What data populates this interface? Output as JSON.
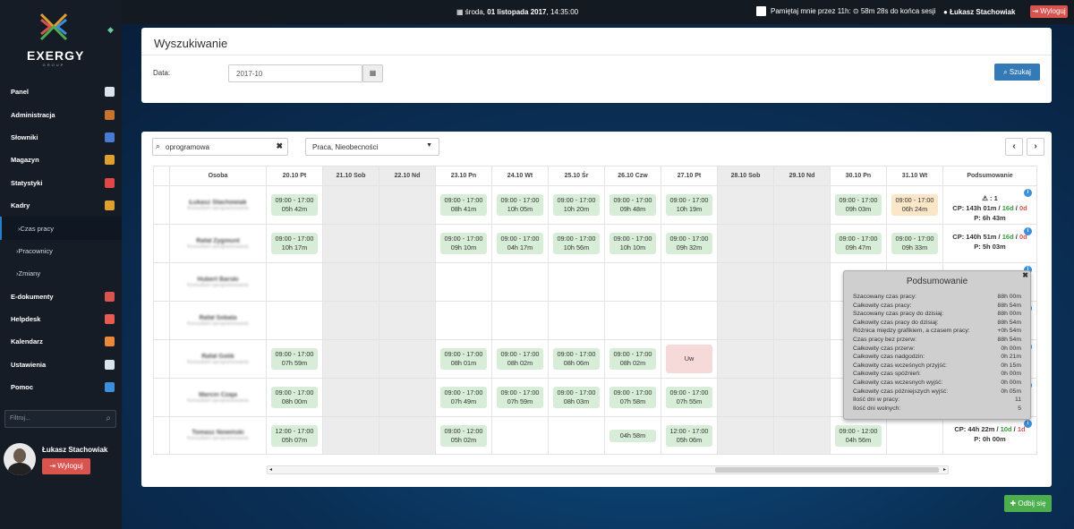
{
  "topbar": {
    "date_prefix": "środa, ",
    "date_bold": "01 listopada 2017",
    "date_time": ", 14:35:00",
    "remember_text": "Pamiętaj mnie przez 11h: ⊙ 58m 28s  do końca sesji",
    "user_name": "Łukasz Stachowiak",
    "logout_label": "Wyloguj"
  },
  "sidebar": {
    "brand": "EXERGY",
    "brand_sub": "GROUP",
    "items": [
      {
        "label": "Panel",
        "icon": "home-icon",
        "color": "#d9e4ef"
      },
      {
        "label": "Administracja",
        "icon": "books-icon",
        "color": "#c9742e"
      },
      {
        "label": "Słowniki",
        "icon": "book-icon",
        "color": "#4a7bd0"
      },
      {
        "label": "Magazyn",
        "icon": "truck-icon",
        "color": "#e0a030"
      },
      {
        "label": "Statystyki",
        "icon": "pie-chart-icon",
        "color": "#e04848"
      },
      {
        "label": "Kadry",
        "icon": "pencil-icon",
        "color": "#e0a030"
      },
      {
        "label": "Czas pracy",
        "icon": "",
        "sub": true,
        "active": true
      },
      {
        "label": "Pracownicy",
        "icon": "",
        "sub": true
      },
      {
        "label": "Zmiany",
        "icon": "",
        "sub": true
      },
      {
        "label": "E-dokumenty",
        "icon": "pdf-icon",
        "color": "#d9534f"
      },
      {
        "label": "Helpdesk",
        "icon": "lifebuoy-icon",
        "color": "#e85a4f"
      },
      {
        "label": "Kalendarz",
        "icon": "calendar-icon",
        "color": "#e88a3a"
      },
      {
        "label": "Ustawienia",
        "icon": "gear-icon",
        "color": "#d9e4ef"
      },
      {
        "label": "Pomoc",
        "icon": "help-icon",
        "color": "#3b8fdc"
      }
    ],
    "filter_placeholder": "Filtruj...",
    "user_name": "Łukasz Stachowiak",
    "logout_label": "Wyloguj"
  },
  "search": {
    "title": "Wyszukiwanie",
    "date_label": "Data:",
    "date_value": "2017-10",
    "search_button": "Szukaj"
  },
  "grid": {
    "filter_value": "oprogramowa",
    "type_select": "Praca, Nieobecności",
    "headers": [
      "Osoba",
      "20.10 Pt",
      "21.10 Sob",
      "22.10 Nd",
      "23.10 Pn",
      "24.10 Wt",
      "25.10 Śr",
      "26.10 Czw",
      "27.10 Pt",
      "28.10 Sob",
      "29.10 Nd",
      "30.10 Pn",
      "31.10 Wt",
      "Podsumowanie"
    ],
    "weekend_cols": [
      2,
      3,
      9,
      10
    ],
    "rows": [
      {
        "name": "Łukasz Stachowiak",
        "role": "Konsultant oprogramowania",
        "cells": [
          [
            "09:00 - 17:00",
            "05h 42m"
          ],
          null,
          null,
          [
            "09:00 - 17:00",
            "08h 41m"
          ],
          [
            "09:00 - 17:00",
            "10h 05m"
          ],
          [
            "09:00 - 17:00",
            "10h 20m"
          ],
          [
            "09:00 - 17:00",
            "09h 48m"
          ],
          [
            "09:00 - 17:00",
            "10h 19m"
          ],
          null,
          null,
          [
            "09:00 - 17:00",
            "09h 03m"
          ],
          [
            "09:00 - 17:00",
            "06h 24m",
            "warn"
          ]
        ],
        "summary": {
          "warn": "⚠ : 1",
          "cp": "CP: 143h 01m / ",
          "g": "16d",
          "r": "0d",
          "p": "P: 6h 43m"
        }
      },
      {
        "name": "Rafał Zygmunt",
        "role": "Konsultant oprogramowania",
        "cells": [
          [
            "09:00 - 17:00",
            "10h 17m"
          ],
          null,
          null,
          [
            "09:00 - 17:00",
            "09h 10m"
          ],
          [
            "09:00 - 17:00",
            "04h 17m"
          ],
          [
            "09:00 - 17:00",
            "10h 56m"
          ],
          [
            "09:00 - 17:00",
            "10h 10m"
          ],
          [
            "09:00 - 17:00",
            "09h 32m"
          ],
          null,
          null,
          [
            "09:00 - 17:00",
            "09h 47m"
          ],
          [
            "09:00 - 17:00",
            "09h 33m"
          ]
        ],
        "summary": {
          "warn": "",
          "cp": "CP: 140h 51m / ",
          "g": "16d",
          "r": "0d",
          "p": "P: 5h 03m"
        }
      },
      {
        "name": "Hubert Barski",
        "role": "Konsultant oprogramowania",
        "cells": [
          null,
          null,
          null,
          null,
          null,
          null,
          null,
          null,
          null,
          null,
          null,
          null
        ],
        "summary": null
      },
      {
        "name": "Rafał Sobala",
        "role": "Konsultant oprogramowania",
        "cells": [
          null,
          null,
          null,
          null,
          null,
          null,
          null,
          null,
          null,
          null,
          null,
          null
        ],
        "summary": null
      },
      {
        "name": "Rafał Golik",
        "role": "Konsultant oprogramowania",
        "cells": [
          [
            "09:00 - 17:00",
            "07h 59m"
          ],
          null,
          null,
          [
            "09:00 - 17:00",
            "08h 01m"
          ],
          [
            "09:00 - 17:00",
            "08h 02m"
          ],
          [
            "09:00 - 17:00",
            "08h 06m"
          ],
          [
            "09:00 - 17:00",
            "08h 02m"
          ],
          [
            "Uw",
            "",
            "uw"
          ],
          null,
          null,
          null,
          null
        ],
        "summary": null
      },
      {
        "name": "Marcin Czaja",
        "role": "Konsultant oprogramowania",
        "cells": [
          [
            "09:00 - 17:00",
            "08h 00m"
          ],
          null,
          null,
          [
            "09:00 - 17:00",
            "07h 49m"
          ],
          [
            "09:00 - 17:00",
            "07h 59m"
          ],
          [
            "09:00 - 17:00",
            "08h 03m"
          ],
          [
            "09:00 - 17:00",
            "07h 58m"
          ],
          [
            "09:00 - 17:00",
            "07h 55m"
          ],
          null,
          null,
          null,
          null
        ],
        "summary": null
      },
      {
        "name": "Tomasz Nowiński",
        "role": "Konsultant oprogramowania",
        "cells": [
          [
            "12:00 - 17:00",
            "05h 07m"
          ],
          null,
          null,
          [
            "09:00 - 12:00",
            "05h 02m"
          ],
          null,
          null,
          [
            "",
            "04h 58m"
          ],
          [
            "12:00 - 17:00",
            "05h 06m"
          ],
          null,
          null,
          [
            "09:00 - 12:00",
            "04h 56m"
          ],
          null
        ],
        "summary": {
          "warn": "",
          "cp": "CP: 44h 22m / ",
          "g": "10d",
          "r": "1d",
          "p": "P: 0h 00m"
        }
      }
    ]
  },
  "popover": {
    "title": "Podsumowanie",
    "rows": [
      [
        "Szacowany czas pracy:",
        "88h 00m"
      ],
      [
        "Całkowity czas pracy:",
        "88h 54m"
      ],
      [
        "Szacowany czas pracy do dzisiaj:",
        "88h 00m"
      ],
      [
        "Całkowity czas pracy do dzisiaj:",
        "88h 54m"
      ],
      [
        "Różnica między grafikiem, a czasem pracy:",
        "+0h 54m"
      ],
      [
        "Czas pracy bez przerw:",
        "88h 54m"
      ],
      [
        "Całkowity czas przerw:",
        "0h 00m"
      ],
      [
        "Całkowity czas nadgodzin:",
        "0h 21m"
      ],
      [
        "Całkowity czas wcześnych przyjść:",
        "0h 15m"
      ],
      [
        "Całkowity czas spóźnień:",
        "0h 00m"
      ],
      [
        "Całkowity czas wczesnych wyjść:",
        "0h 00m"
      ],
      [
        "Całkowity czas późniejszych wyjść:",
        "0h 05m"
      ],
      [
        "Ilość dni w pracy:",
        "11"
      ],
      [
        "Ilość dni wolnych:",
        "5"
      ]
    ]
  },
  "punch_button": "Odbij się"
}
